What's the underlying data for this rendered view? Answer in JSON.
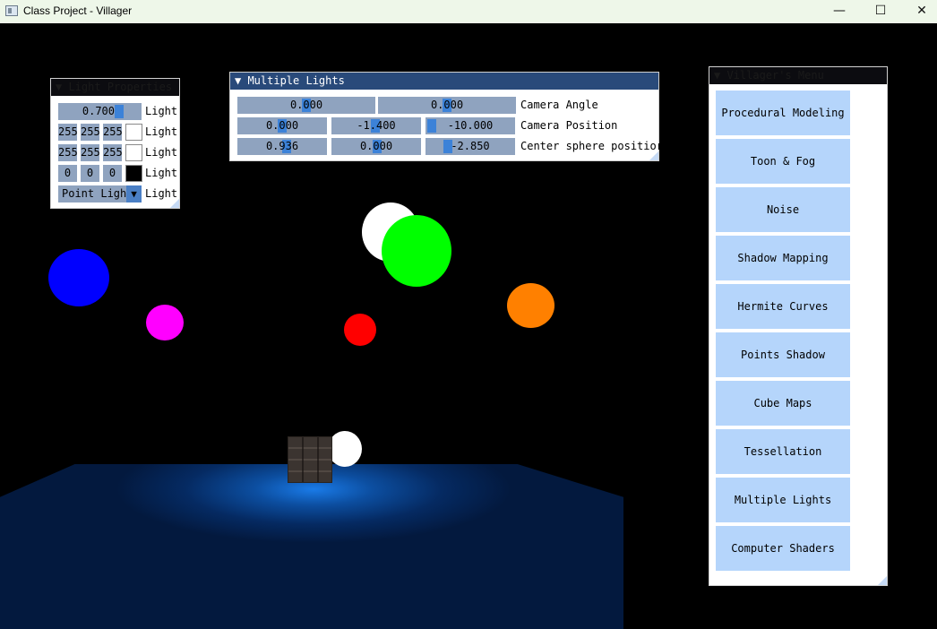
{
  "window": {
    "title": "Class Project - Villager",
    "minimize_glyph": "—",
    "maximize_glyph": "☐",
    "close_glyph": "✕"
  },
  "light_panel": {
    "title": "▼ Light Properties",
    "intensity": "0.700",
    "intensity_label": "Light",
    "color_a": [
      "255",
      "255",
      "255"
    ],
    "color_a_label": "Light",
    "color_a_swatch": "#ffffff",
    "color_b": [
      "255",
      "255",
      "255"
    ],
    "color_b_label": "Light",
    "color_b_swatch": "#ffffff",
    "color_c": [
      "0",
      "0",
      "0"
    ],
    "color_c_label": "Light",
    "color_c_swatch": "#000000",
    "type_value": "Point Ligh",
    "type_arrow": "▼",
    "type_label": "Light"
  },
  "lights_panel": {
    "title": "▼ Multiple Lights",
    "camera_angle": [
      "0.000",
      "0.000"
    ],
    "camera_angle_label": "Camera Angle",
    "camera_position": [
      "0.000",
      "-1.400",
      "-10.000"
    ],
    "camera_position_label": "Camera Position",
    "sphere_position": [
      "0.936",
      "0.000",
      "-2.850"
    ],
    "sphere_position_label": "Center sphere positior"
  },
  "menu_panel": {
    "title": "▼ Villager's Menu",
    "items": [
      "Procedural Modeling",
      "Toon & Fog",
      "Noise",
      "Shadow Mapping",
      "Hermite Curves",
      "Points Shadow",
      "Cube Maps",
      "Tessellation",
      "Multiple Lights",
      "Computer Shaders"
    ]
  },
  "scene_colors": {
    "blue": "#0000ff",
    "magenta": "#ff00ff",
    "white": "#ffffff",
    "green": "#00ff00",
    "orange": "#ff8000",
    "red": "#ff0000"
  }
}
